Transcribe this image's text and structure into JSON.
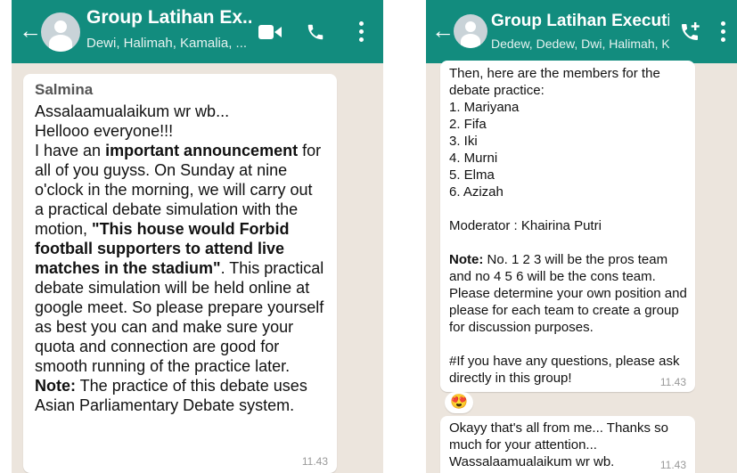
{
  "left_chat": {
    "title": "Group Latihan Ex...",
    "subtitle": "Dewi, Halimah, Kamalia, ...",
    "message": {
      "sender": "Salmina",
      "line1": "Assalaamualaikum wr wb...",
      "line2": "Hellooo everyone!!!",
      "p1_pre": "I have an ",
      "p1_bold": "important announcement",
      "p1_post": " for all of you guyss. On Sunday at nine o'clock in the morning, we will carry out a practical debate simulation with the motion, ",
      "motion": "\"This house would Forbid football supporters to attend live matches in the stadium\"",
      "p1_end": ". This practical debate simulation will be held online at google meet. So please prepare yourself as best you can and make sure your quota and connection are good for smooth running of the practice later.",
      "note_label": "Note:",
      "note_text": " The practice of this debate uses Asian Parliamentary Debate system.",
      "time": "11.43"
    }
  },
  "right_chat": {
    "title": "Group Latihan Executive",
    "subtitle": "Dedew, Dedew, Dwi, Halimah, Ka...",
    "message1": {
      "intro": "Then, here are the members for the debate practice:",
      "members": [
        "1. Mariyana",
        "2. Fifa",
        "3. Iki",
        "4. Murni",
        "5. Elma",
        "6. Azizah"
      ],
      "moderator": "Moderator : Khairina Putri",
      "note_label": "Note:",
      "note_text": " No. 1 2 3 will be the pros team and no 4 5 6 will be the cons team. Please determine your own position and please for each team to create a group for discussion purposes.",
      "closing": "#If you have any questions, please ask directly in this group!",
      "time": "11.43"
    },
    "reaction": "😍",
    "message2": {
      "text": "Okayy that's all from me... Thanks so much for your attention... Wassalaamualaikum wr wb.",
      "time": "11.43"
    }
  }
}
